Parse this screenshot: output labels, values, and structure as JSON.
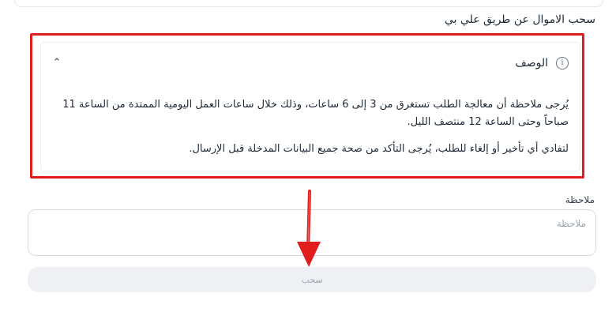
{
  "section": {
    "title": "سحب الاموال عن طريق علي بي"
  },
  "description": {
    "label": "الوصف",
    "paragraph_1": "يُرجى ملاحظة أن معالجة الطلب تستغرق من 3 إلى 6 ساعات، وذلك خلال ساعات العمل اليومية الممتدة من الساعة 11 صباحاً وحتى الساعة 12 منتصف الليل.",
    "paragraph_2": "لتفادي أي تأخير أو إلغاء للطلب، يُرجى التأكد من صحة جميع البيانات المدخلة قبل الإرسال."
  },
  "note": {
    "label": "ملاحظة",
    "placeholder": "ملاحظة",
    "value": ""
  },
  "submit": {
    "label": "سحب"
  },
  "colors": {
    "highlight_border": "#e11d1d",
    "button_bg": "#eef0f3",
    "muted_text": "#9ca3af"
  },
  "icons": {
    "info": "info-icon",
    "collapse": "chevron-up-icon",
    "annotation_arrow": "arrow-down-icon"
  }
}
